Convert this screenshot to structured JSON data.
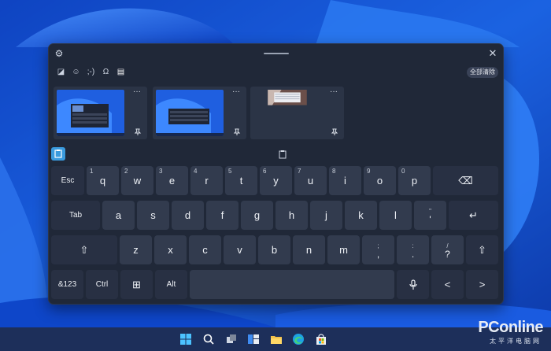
{
  "colors": {
    "accent": "#3a9bde",
    "window": "#202838",
    "key": "#323b4e",
    "key_func": "#283043",
    "taskbar": "#1d2f5a"
  },
  "titlebar": {
    "settings_icon": "gear-icon",
    "close_label": "✕"
  },
  "category_tabs": [
    {
      "name": "sticker-icon",
      "glyph": "◪"
    },
    {
      "name": "emoji-icon",
      "glyph": "☺"
    },
    {
      "name": "kaomoji-icon",
      "glyph": ";-)"
    },
    {
      "name": "symbols-icon",
      "glyph": "Ω"
    },
    {
      "name": "clipboard-icon",
      "glyph": "▤"
    }
  ],
  "clipboard": {
    "clear_all_label": "全部清除",
    "items": [
      {
        "more_label": "···"
      },
      {
        "more_label": "···"
      },
      {
        "more_label": "···"
      }
    ]
  },
  "keyboard": {
    "row1": [
      {
        "label": "Esc"
      },
      {
        "label": "q",
        "sup": "1"
      },
      {
        "label": "w",
        "sup": "2"
      },
      {
        "label": "e",
        "sup": "3"
      },
      {
        "label": "r",
        "sup": "4"
      },
      {
        "label": "t",
        "sup": "5"
      },
      {
        "label": "y",
        "sup": "6"
      },
      {
        "label": "u",
        "sup": "7"
      },
      {
        "label": "i",
        "sup": "8"
      },
      {
        "label": "o",
        "sup": "9"
      },
      {
        "label": "p",
        "sup": "0"
      },
      {
        "label": "⌫"
      }
    ],
    "row2": [
      {
        "label": "Tab"
      },
      {
        "label": "a"
      },
      {
        "label": "s"
      },
      {
        "label": "d"
      },
      {
        "label": "f"
      },
      {
        "label": "g"
      },
      {
        "label": "h"
      },
      {
        "label": "j"
      },
      {
        "label": "k"
      },
      {
        "label": "l"
      },
      {
        "label": "'",
        "top": "\""
      },
      {
        "label": "↵"
      }
    ],
    "row3": [
      {
        "label": "⇧"
      },
      {
        "label": "z"
      },
      {
        "label": "x"
      },
      {
        "label": "c"
      },
      {
        "label": "v"
      },
      {
        "label": "b"
      },
      {
        "label": "n"
      },
      {
        "label": "m"
      },
      {
        "label": ",",
        "top": ";"
      },
      {
        "label": ".",
        "top": ":"
      },
      {
        "label": "?",
        "top": "/"
      },
      {
        "label": "⇧"
      }
    ],
    "row4": [
      {
        "label": "&123"
      },
      {
        "label": "Ctrl"
      },
      {
        "label": "⊞"
      },
      {
        "label": "Alt"
      },
      {
        "label": ""
      },
      {
        "label": "🎤"
      },
      {
        "label": "<"
      },
      {
        "label": ">"
      }
    ]
  },
  "taskbar": {
    "icons": [
      "windows-start-icon",
      "search-icon",
      "task-view-icon",
      "widgets-icon",
      "file-explorer-icon",
      "edge-icon",
      "store-icon"
    ]
  },
  "watermark": {
    "brand": "PConline",
    "sub": "太平洋电脑网"
  }
}
